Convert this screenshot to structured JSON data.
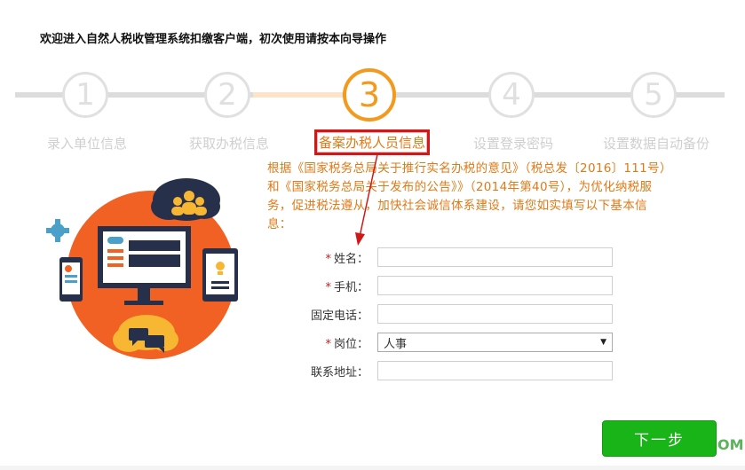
{
  "header": {
    "title": "欢迎进入自然人税收管理系统扣缴客户端，初次使用请按本向导操作"
  },
  "steps": [
    {
      "number": "1",
      "label": "录入单位信息"
    },
    {
      "number": "2",
      "label": "获取办税信息"
    },
    {
      "number": "3",
      "label": "备案办税人员信息"
    },
    {
      "number": "4",
      "label": "设置登录密码"
    },
    {
      "number": "5",
      "label": "设置数据自动备份"
    }
  ],
  "current_step": 3,
  "description": "根据《国家税务总局关于推行实名办税的意见》（税总发〔2016〕111号）和《国家税务总局关于发布的公告》》（2014年第40号），为优化纳税服务，促进税法遵从，加快社会诚信体系建设，请您如实填写以下基本信息：",
  "form": {
    "name_label": "姓名：",
    "phone_label": "手机：",
    "landline_label": "固定电话：",
    "position_label": "岗位：",
    "position_value": "人事",
    "address_label": "联系地址：",
    "required_mark": "*"
  },
  "buttons": {
    "next": "下一步"
  },
  "watermark": "OM",
  "colors": {
    "accent": "#f39a1e",
    "text_orange": "#e07a18",
    "highlight_red": "#d01818",
    "button_green": "#18b418"
  }
}
